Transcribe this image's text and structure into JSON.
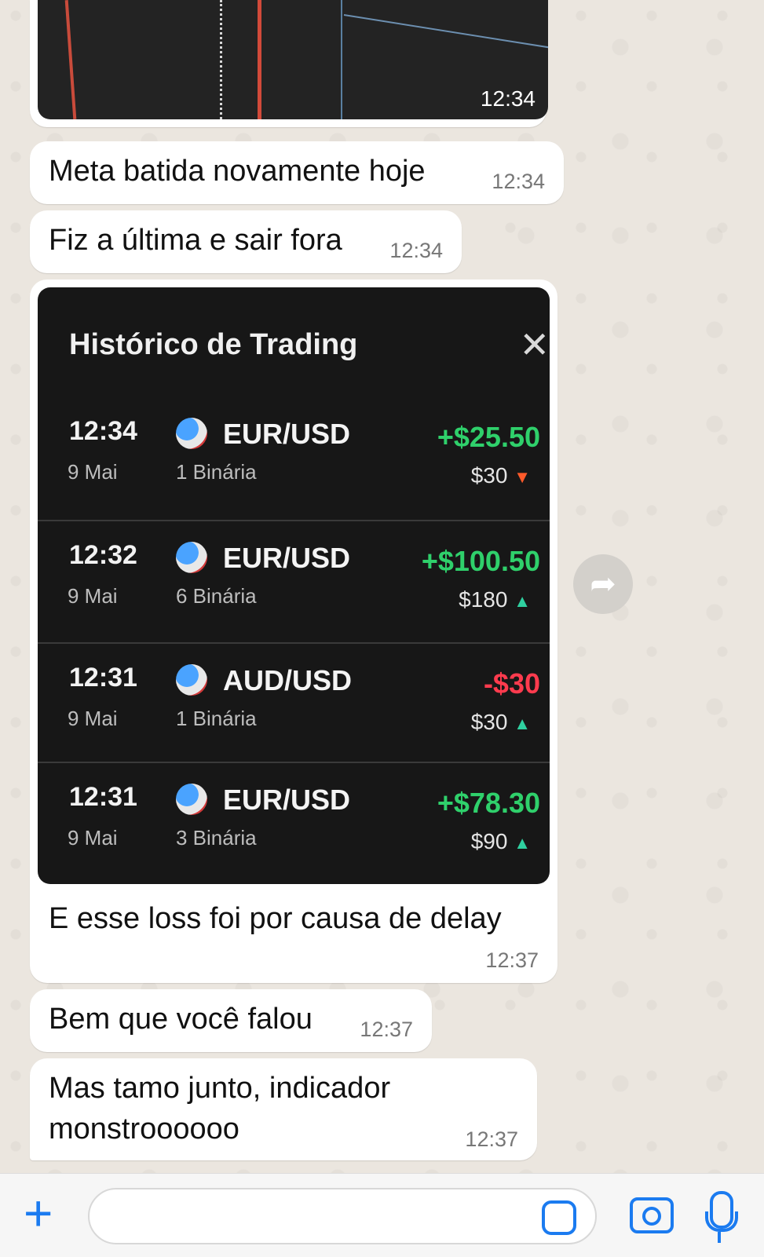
{
  "messages": {
    "m1": {
      "timestamp": "12:34"
    },
    "m2": {
      "text": "Meta batida novamente hoje",
      "timestamp": "12:34"
    },
    "m3": {
      "text": "Fiz a última e sair fora",
      "timestamp": "12:34"
    },
    "m4": {
      "caption": "E esse loss foi por causa de delay",
      "timestamp": "12:37",
      "trading_history": {
        "title": "Histórico de Trading",
        "close_glyph": "✕",
        "rows": [
          {
            "time": "12:34",
            "date": "9 Mai",
            "pair": "EUR/USD",
            "type": "1 Binária",
            "pl": "+$25.50",
            "pl_sign": "pos",
            "amount": "$30",
            "direction": "down",
            "arrow": "▼"
          },
          {
            "time": "12:32",
            "date": "9 Mai",
            "pair": "EUR/USD",
            "type": "6 Binária",
            "pl": "+$100.50",
            "pl_sign": "pos",
            "amount": "$180",
            "direction": "up",
            "arrow": "▲"
          },
          {
            "time": "12:31",
            "date": "9 Mai",
            "pair": "AUD/USD",
            "type": "1 Binária",
            "pl": "-$30",
            "pl_sign": "neg",
            "amount": "$30",
            "direction": "up",
            "arrow": "▲"
          },
          {
            "time": "12:31",
            "date": "9 Mai",
            "pair": "EUR/USD",
            "type": "3 Binária",
            "pl": "+$78.30",
            "pl_sign": "pos",
            "amount": "$90",
            "direction": "up",
            "arrow": "▲"
          }
        ]
      }
    },
    "m5": {
      "text": "Bem que você falou",
      "timestamp": "12:37"
    },
    "m6": {
      "line1": "Mas tamo junto, indicador",
      "line2": "monstroooooo",
      "timestamp": "12:37"
    }
  },
  "input": {
    "placeholder": ""
  },
  "icons": {
    "plus": "plus-icon",
    "sticker": "sticker-icon",
    "camera": "camera-icon",
    "mic": "microphone-icon",
    "forward": "forward-icon"
  },
  "colors": {
    "accent": "#1b7bf0",
    "profit": "#2fd06b",
    "loss": "#ff3b4e"
  }
}
